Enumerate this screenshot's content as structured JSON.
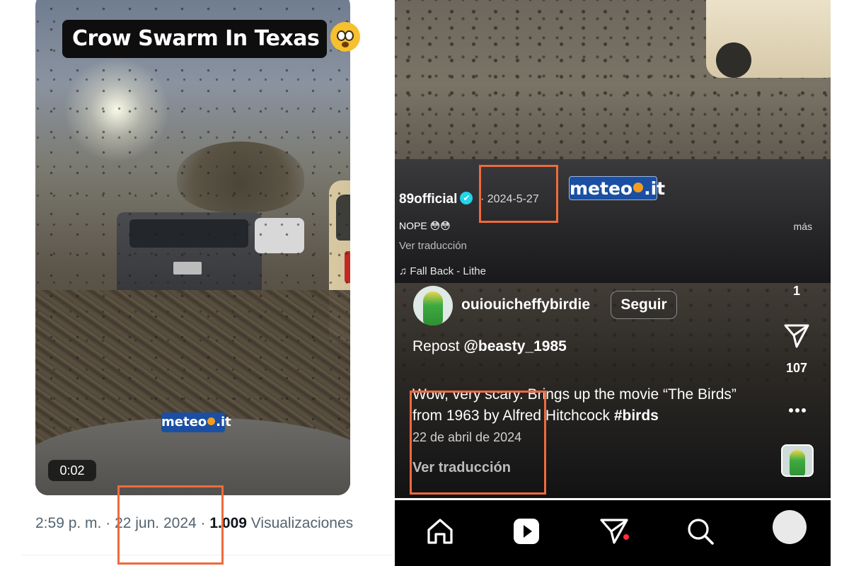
{
  "left_post": {
    "video_caption": "Crow Swarm In Texas",
    "caption_emoji": "flushed-face-emoji",
    "watermark": "meteo.it",
    "duration": "0:02",
    "time": "2:59 p. m.",
    "separator": "·",
    "date": "22 jun. 2024",
    "views_count": "1.009",
    "views_label": "Visualizaciones"
  },
  "tiktok_overlay": {
    "username": "89official",
    "verified_badge": "✔",
    "date": "· 2024-5-27",
    "watermark": "meteo.it",
    "caption": "NOPE 😳😳",
    "more_label": "más",
    "translate_label": "Ver traducción",
    "music_note": "♫",
    "music": "Fall Back - Lithe"
  },
  "instagram_post": {
    "username": "ouiouicheffybirdie",
    "follow_label": "Seguir",
    "repost_prefix": "Repost",
    "repost_handle": "@beasty_1985",
    "caption_text": "Wow, very scary. Brings up the movie “The Birds” from 1963 by Alfred Hitchcock",
    "caption_hashtag": "#birds",
    "date": "22 de abril de 2024",
    "translate_label": "Ver traducción",
    "likes_count": "1",
    "shares_count": "107",
    "progress": 1.0
  },
  "nav_items": [
    {
      "name": "home",
      "icon": "home-icon"
    },
    {
      "name": "reels",
      "icon": "reels-icon"
    },
    {
      "name": "messages",
      "icon": "send-icon"
    },
    {
      "name": "search",
      "icon": "search-icon"
    },
    {
      "name": "profile",
      "icon": "profile-avatar"
    }
  ],
  "colors": {
    "highlight": "#ef6a3c",
    "meteo_blue": "#1a4fa3",
    "meteo_dot": "#f39c1f",
    "x_gray_text": "#536471",
    "notification_red": "#ff2d3d"
  }
}
